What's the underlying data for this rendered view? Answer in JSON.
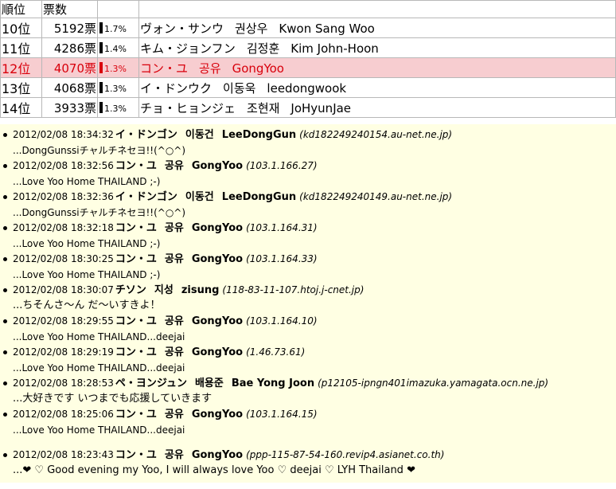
{
  "ranking": {
    "header": {
      "rank": "順位",
      "votes": "票数"
    },
    "rows": [
      {
        "rank": "10位",
        "votes": "5192票",
        "pct": "1.7%",
        "jp": "ヴォン・サンウ",
        "kr": "권상우",
        "en": "Kwon Sang Woo",
        "highlight": false
      },
      {
        "rank": "11位",
        "votes": "4286票",
        "pct": "1.4%",
        "jp": "キム・ジョンフン",
        "kr": "김정훈",
        "en": "Kim John-Hoon",
        "highlight": false
      },
      {
        "rank": "12位",
        "votes": "4070票",
        "pct": "1.3%",
        "jp": "コン・ユ",
        "kr": "공유",
        "en": "GongYoo",
        "highlight": true
      },
      {
        "rank": "13位",
        "votes": "4068票",
        "pct": "1.3%",
        "jp": "イ・ドンウク",
        "kr": "이동욱",
        "en": "leedongwook",
        "highlight": false
      },
      {
        "rank": "14位",
        "votes": "3933票",
        "pct": "1.3%",
        "jp": "チョ・ヒョンジェ",
        "kr": "조현재",
        "en": "JoHyunJae",
        "highlight": false
      }
    ]
  },
  "comments": [
    {
      "date": "2012/02/08 18:34:32",
      "jp": "イ・ドンゴン",
      "kr": "이동건",
      "en": "LeeDongGun",
      "host": "(kd182249240154.au-net.ne.jp)",
      "message": "...DongGunssiチャルチネセヨ!!(^○^)"
    },
    {
      "date": "2012/02/08 18:32:56",
      "jp": "コン・ユ",
      "kr": "공유",
      "en": "GongYoo",
      "host": "(103.1.166.27)",
      "message": "...Love Yoo Home THAILAND ;-)"
    },
    {
      "date": "2012/02/08 18:32:36",
      "jp": "イ・ドンゴン",
      "kr": "이동건",
      "en": "LeeDongGun",
      "host": "(kd182249240149.au-net.ne.jp)",
      "message": "...DongGunssiチャルチネセヨ!!(^○^)"
    },
    {
      "date": "2012/02/08 18:32:18",
      "jp": "コン・ユ",
      "kr": "공유",
      "en": "GongYoo",
      "host": "(103.1.164.31)",
      "message": "...Love Yoo Home THAILAND ;-)"
    },
    {
      "date": "2012/02/08 18:30:25",
      "jp": "コン・ユ",
      "kr": "공유",
      "en": "GongYoo",
      "host": "(103.1.164.33)",
      "message": "...Love Yoo Home THAILAND ;-)"
    },
    {
      "date": "2012/02/08 18:30:07",
      "jp": "チソン",
      "kr": "지성",
      "en": "zisung",
      "host": "(118-83-11-107.htoj.j-cnet.jp)",
      "message": "...ちそんさ～ん だ～いすきよ！"
    },
    {
      "date": "2012/02/08 18:29:55",
      "jp": "コン・ユ",
      "kr": "공유",
      "en": "GongYoo",
      "host": "(103.1.164.10)",
      "message": "...Love Yoo Home THAILAND...deejai"
    },
    {
      "date": "2012/02/08 18:29:19",
      "jp": "コン・ユ",
      "kr": "공유",
      "en": "GongYoo",
      "host": "(1.46.73.61)",
      "message": "...Love Yoo Home THAILAND...deejai"
    },
    {
      "date": "2012/02/08 18:28:53",
      "jp": "ペ・ヨンジュン",
      "kr": "배용준",
      "en": "Bae Yong Joon",
      "host": "(p12105-ipngn401imazuka.yamagata.ocn.ne.jp)",
      "message": "...大好きです いつまでも応援していきます"
    },
    {
      "date": "2012/02/08 18:25:06",
      "jp": "コン・ユ",
      "kr": "공유",
      "en": "GongYoo",
      "host": "(103.1.164.15)",
      "message": "...Love Yoo Home THAILAND...deejai"
    },
    {
      "date": "2012/02/08 18:23:43",
      "jp": "コン・ユ",
      "kr": "공유",
      "en": "GongYoo",
      "host": "(ppp-115-87-54-160.revip4.asianet.co.th)",
      "message": "...❤ ♡ Good evening my Yoo, I will always love Yoo ♡ deejai ♡ LYH Thailand ❤"
    }
  ]
}
